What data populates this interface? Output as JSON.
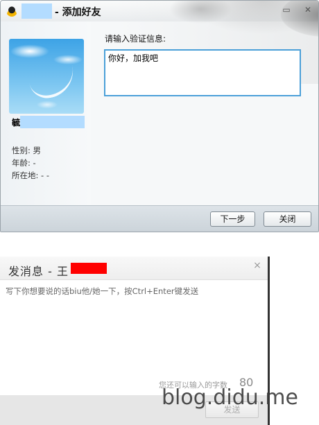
{
  "add_friend_dialog": {
    "title": "- 添加好友",
    "minimize_glyph": "▭",
    "close_glyph": "✕",
    "profile": {
      "nickname_char": "毓",
      "gender": "性别: 男",
      "age": "年龄: -",
      "location": "所在地: -  -"
    },
    "verify_label": "请输入验证信息:",
    "verify_value": "你好，加我吧",
    "buttons": {
      "next": "下一步",
      "close": "关闭"
    },
    "colors": {
      "accent_border": "#4a9fd8",
      "mask": "#b3dcff"
    }
  },
  "message_dialog": {
    "title": "发消息 - ",
    "title_suffix": "王",
    "close_glyph": "×",
    "placeholder": "写下你想要说的话biu他/她一下，按Ctrl+Enter键发送",
    "remaining_label": "您还可以输入的字数",
    "remaining_count": "80",
    "send_button": "发送",
    "colors": {
      "redaction": "#ff0000"
    }
  },
  "watermark": "blog.didu.me"
}
